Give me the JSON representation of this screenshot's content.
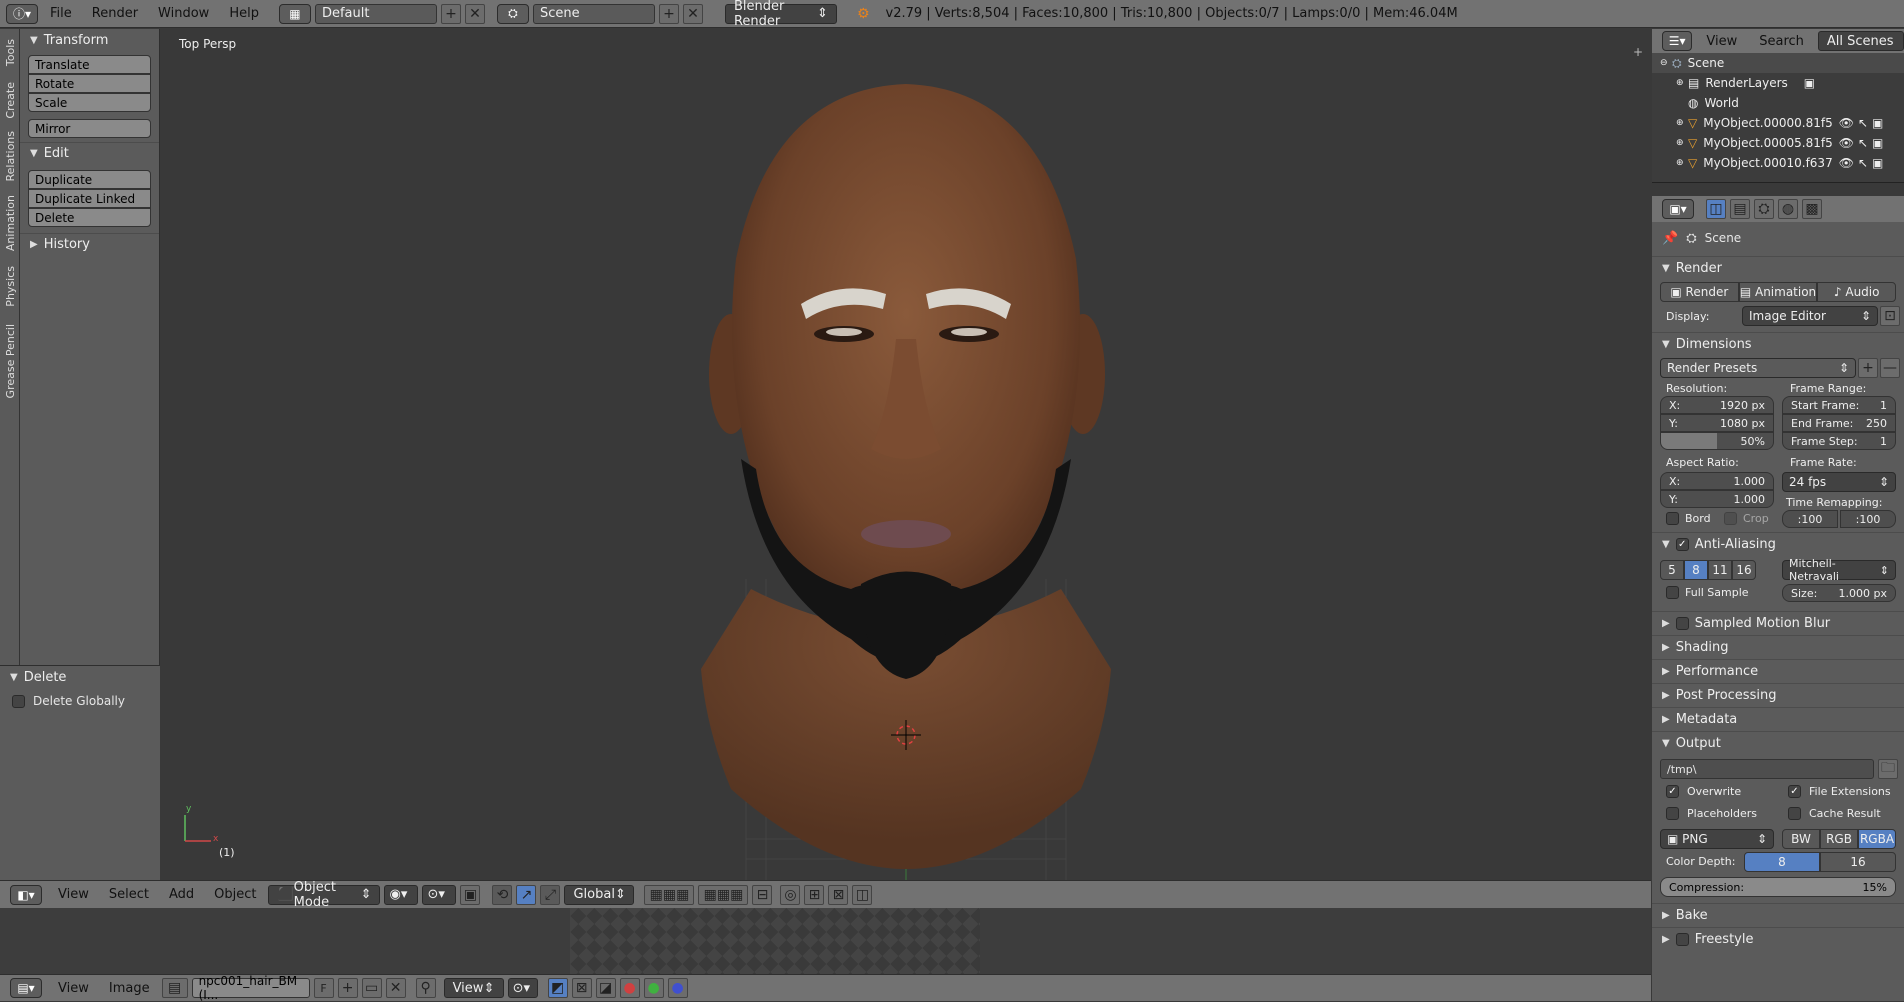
{
  "topbar": {
    "menus": [
      "File",
      "Render",
      "Window",
      "Help"
    ],
    "screen_layout": "Default",
    "scene": "Scene",
    "engine": "Blender Render",
    "stats": "v2.79 | Verts:8,504 | Faces:10,800 | Tris:10,800 | Objects:0/7 | Lamps:0/0 | Mem:46.04M"
  },
  "tabs": [
    "Tools",
    "Create",
    "Relations",
    "Animation",
    "Physics",
    "Grease Pencil"
  ],
  "toolshelf": {
    "transform": {
      "title": "Transform",
      "buttons": [
        "Translate",
        "Rotate",
        "Scale"
      ],
      "mirror": "Mirror"
    },
    "edit": {
      "title": "Edit",
      "buttons": [
        "Duplicate",
        "Duplicate Linked",
        "Delete"
      ]
    },
    "history": {
      "title": "History"
    },
    "operator": {
      "title": "Delete",
      "option": "Delete Globally"
    }
  },
  "viewport": {
    "view_name": "Top Persp",
    "frame": "(1)"
  },
  "viewport_header": {
    "menus": [
      "View",
      "Select",
      "Add",
      "Object"
    ],
    "mode": "Object Mode",
    "orientation": "Global"
  },
  "image_header": {
    "menus": [
      "View",
      "Image"
    ],
    "image_name": "npc001_hair_BM (I...",
    "f_label": "F",
    "view": "View"
  },
  "outliner": {
    "menus": [
      "View",
      "Search"
    ],
    "filter": "All Scenes",
    "items": [
      "Scene",
      "RenderLayers",
      "World",
      "MyObject.00000.81f5",
      "MyObject.00005.81f5",
      "MyObject.00010.f637"
    ]
  },
  "properties": {
    "context": "Scene",
    "render": {
      "title": "Render",
      "buttons": [
        "Render",
        "Animation",
        "Audio"
      ],
      "display_label": "Display:",
      "display_value": "Image Editor"
    },
    "dimensions": {
      "title": "Dimensions",
      "presets": "Render Presets",
      "resolution_label": "Resolution:",
      "res_x_label": "X:",
      "res_x": "1920 px",
      "res_y_label": "Y:",
      "res_y": "1080 px",
      "res_pct": "50%",
      "frame_range_label": "Frame Range:",
      "start_label": "Start Frame:",
      "start": "1",
      "end_label": "End Frame:",
      "end": "250",
      "step_label": "Frame Step:",
      "step": "1",
      "aspect_label": "Aspect Ratio:",
      "asp_x_label": "X:",
      "asp_x": "1.000",
      "asp_y_label": "Y:",
      "asp_y": "1.000",
      "frame_rate_label": "Frame Rate:",
      "fps": "24 fps",
      "time_remap_label": "Time Remapping:",
      "remap_old": ":100",
      "remap_new": ":100",
      "bord": "Bord",
      "crop": "Crop"
    },
    "anti_aliasing": {
      "title": "Anti-Aliasing",
      "samples": [
        "5",
        "8",
        "11",
        "16"
      ],
      "filter": "Mitchell-Netravali",
      "full_sample": "Full Sample",
      "size_label": "Size:",
      "size": "1.000 px"
    },
    "collapsed": [
      "Sampled Motion Blur",
      "Shading",
      "Performance",
      "Post Processing",
      "Metadata"
    ],
    "output": {
      "title": "Output",
      "path": "/tmp\\",
      "overwrite": "Overwrite",
      "file_extensions": "File Extensions",
      "placeholders": "Placeholders",
      "cache_result": "Cache Result",
      "format": "PNG",
      "channels": [
        "BW",
        "RGB",
        "RGBA"
      ],
      "color_depth_label": "Color Depth:",
      "depths": [
        "8",
        "16"
      ],
      "compression_label": "Compression:",
      "compression": "15%"
    },
    "bottom": [
      "Bake",
      "Freestyle"
    ]
  },
  "colors": {
    "accent": "#5680c2",
    "header": "#727272",
    "viewport_bg": "#393939"
  }
}
